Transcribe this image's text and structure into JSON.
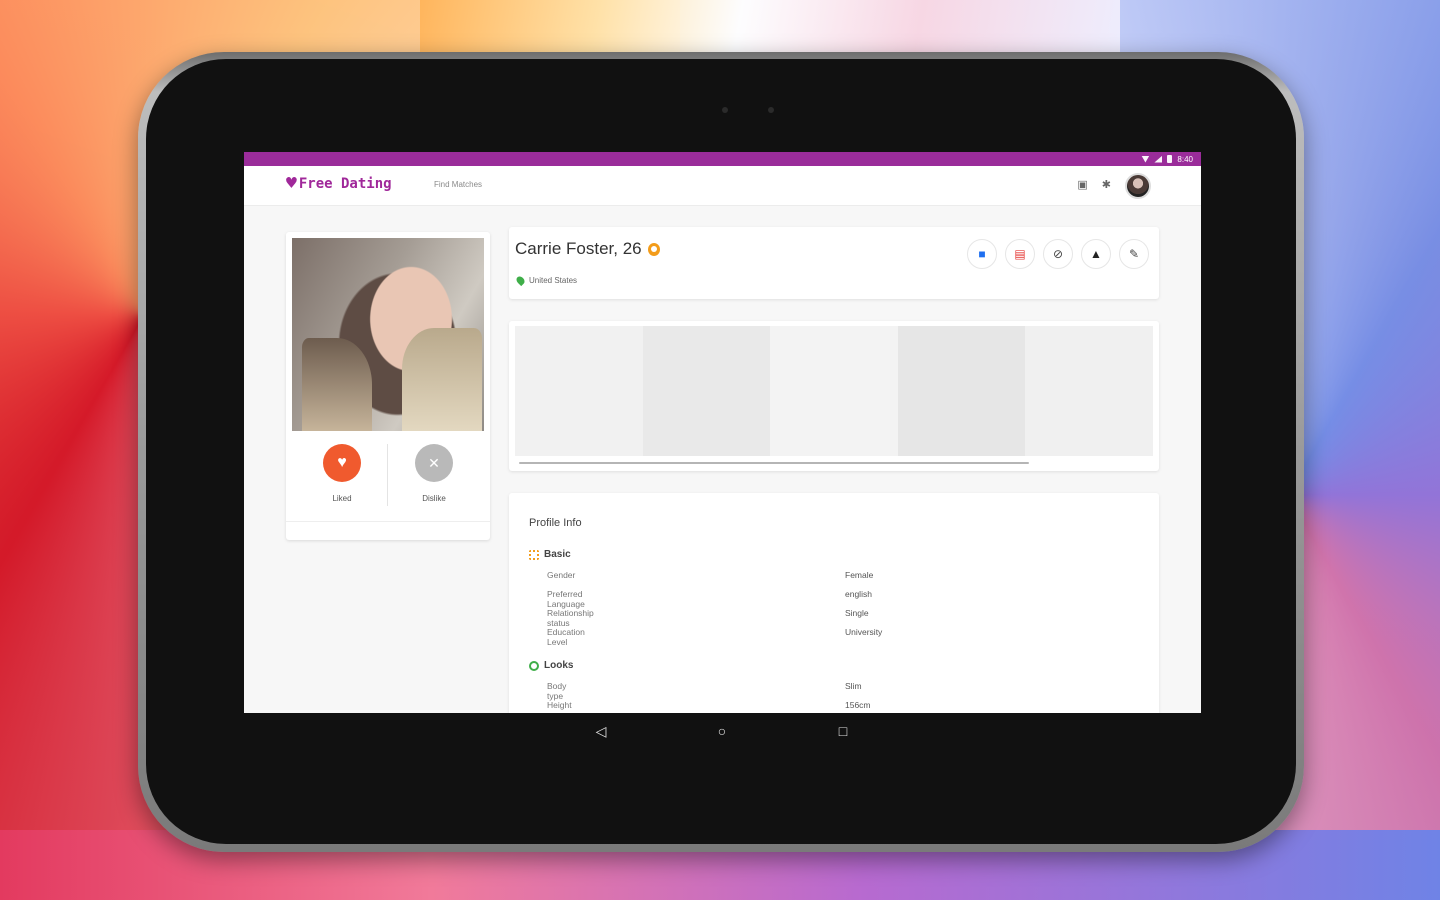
{
  "status_bar": {
    "time": "8:40"
  },
  "app": {
    "logo_text": "Free Dating",
    "nav_link": "Find Matches"
  },
  "profile": {
    "name_age": "Carrie Foster, 26",
    "location": "United States",
    "like_label": "Liked",
    "dislike_label": "Dislike"
  },
  "info": {
    "title": "Profile Info",
    "basic": {
      "heading": "Basic",
      "rows": [
        {
          "key": "Gender",
          "value": "Female"
        },
        {
          "key": "Preferred Language",
          "value": "english"
        },
        {
          "key": "Relationship status",
          "value": "Single"
        },
        {
          "key": "Education Level",
          "value": "University"
        }
      ]
    },
    "looks": {
      "heading": "Looks",
      "rows": [
        {
          "key": "Body type",
          "value": "Slim"
        },
        {
          "key": "Height",
          "value": "156cm"
        }
      ]
    }
  },
  "icons": {
    "header_actions": [
      "message-icon",
      "gift-icon",
      "block-icon",
      "report-icon",
      "edit-icon"
    ],
    "appbar": [
      "chat-icon",
      "notification-icon"
    ],
    "system_nav": [
      "back-icon",
      "home-icon",
      "recent-apps-icon"
    ]
  },
  "colors": {
    "brand": "#9a2c9a",
    "like": "#f05a2e",
    "dislike": "#b9b9b9",
    "verified": "#f39c1a"
  }
}
